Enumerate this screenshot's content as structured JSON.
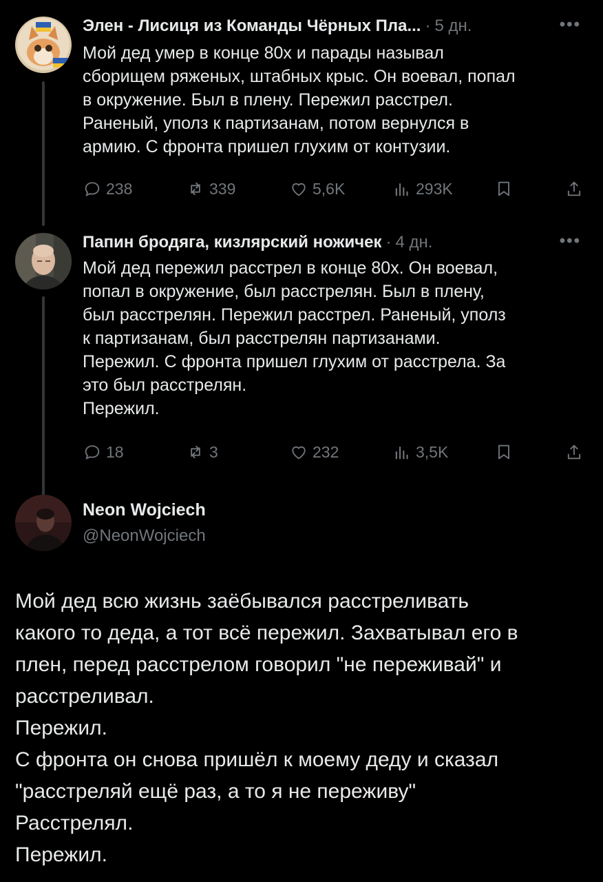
{
  "tweets": [
    {
      "name": "Элен - Лисиця из Команды Чёрных Пла...",
      "dot": "·",
      "time": "5 дн.",
      "more": "•••",
      "lines": [
        "Мой дед умер в конце 80х и парады называл",
        "сборищем ряженых, штабных крыс. Он воевал, попал",
        "в окружение. Был в плену. Пережил расстрел.",
        "Раненый, уполз к партизанам, потом вернулся в",
        "армию. С фронта пришел глухим от контузии."
      ],
      "replies": "238",
      "reposts": "339",
      "likes": "5,6K",
      "views": "293K"
    },
    {
      "name": "Папин бродяга, кизлярский ножичек",
      "dot": "·",
      "time": "4 дн.",
      "more": "•••",
      "lines": [
        "Мой дед пережил расстрел в конце 80х. Он воевал,",
        "попал в окружение, был расстрелян. Был в плену,",
        "был расстрелян. Пережил расстрел. Раненый, уполз",
        "к партизанам, был расстрелян партизанами.",
        "Пережил. С фронта пришел глухим от расстрела. За",
        "это был расстрелян.",
        "Пережил."
      ],
      "replies": "18",
      "reposts": "3",
      "likes": "232",
      "views": "3,5K"
    }
  ],
  "main": {
    "name": "Neon Wojciech",
    "handle": "@NeonWojciech",
    "lines": [
      "Мой дед всю жизнь заёбывался расстреливать",
      "какого то деда, а тот всё пережил. Захватывал его в",
      "плен, перед расстрелом говорил \"не переживай\" и",
      "расстреливал.",
      "Пережил.",
      "С фронта он снова пришёл к моему деду и сказал",
      "\"расстреляй ещё раз, а то я не переживу\"",
      "Расстрелял.",
      "Пережил."
    ]
  },
  "icons": {
    "reply": "reply-icon",
    "repost": "repost-icon",
    "like": "like-icon",
    "views": "views-icon",
    "bookmark": "bookmark-icon",
    "share": "share-icon"
  },
  "colors": {
    "background": "#000000",
    "text": "#e7e9ea",
    "muted": "#71767b",
    "thread_line": "#333639"
  }
}
